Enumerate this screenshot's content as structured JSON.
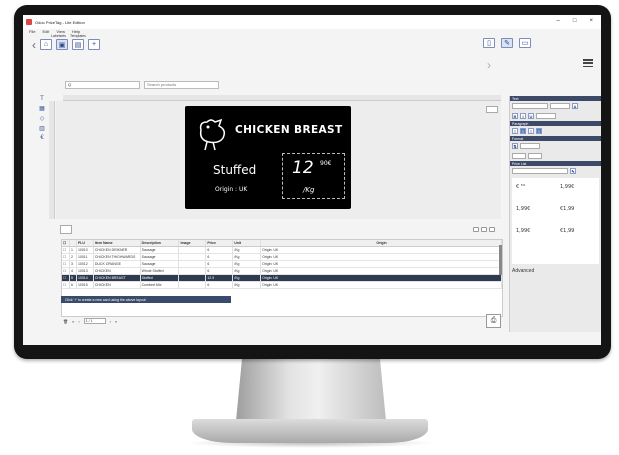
{
  "window": {
    "title": "Odoo PriceTag - Lite Edition",
    "minimize": "–",
    "maximize": "□",
    "close": "×"
  },
  "menu": [
    "File",
    "Edit",
    "View",
    "Help"
  ],
  "subnav": [
    "Labelsets",
    "Templates"
  ],
  "search": {
    "value": "Q",
    "placeholder": "Search products"
  },
  "label": {
    "title": "CHICKEN BREAST",
    "description": "Stuffed",
    "origin": "Origin : UK",
    "price": "12",
    "cents": "90€",
    "unit": "/Kg"
  },
  "table": {
    "headers": [
      "",
      "PLU",
      "Item Name",
      "Description",
      "Image",
      "Price",
      "Unit",
      "Origin"
    ],
    "rows": [
      {
        "num": "1",
        "plu": "10010",
        "name": "CHICKEN DRIKNER",
        "desc": "Sausage",
        "price": "6",
        "unit": "/Kg",
        "origin": "Origin: UK"
      },
      {
        "num": "2",
        "plu": "10011",
        "name": "CHICKEN THIGHWARDS",
        "desc": "Sausage",
        "price": "6",
        "unit": "/Kg",
        "origin": "Origin: UK"
      },
      {
        "num": "3",
        "plu": "10012",
        "name": "DUCK ORANGE",
        "desc": "Sausage",
        "price": "6",
        "unit": "/Kg",
        "origin": "Origin: UK"
      },
      {
        "num": "4",
        "plu": "10013",
        "name": "CHICKEN",
        "desc": "Whole Stuffed",
        "price": "6",
        "unit": "/Kg",
        "origin": "Origin: UK"
      },
      {
        "num": "5",
        "plu": "10014",
        "name": "CHICKEN BREAST",
        "desc": "Stuffed",
        "price": "12.9",
        "unit": "/Kg",
        "origin": "Origin: UK"
      },
      {
        "num": "6",
        "plu": "10015",
        "name": "CHICKEN",
        "desc": "Cumbert Mix",
        "price": "6",
        "unit": "/Kg",
        "origin": "Origin: UK"
      }
    ],
    "hint": "Click '+' to create a new card using the above layout"
  },
  "pager": {
    "value": "1 / 1"
  },
  "panel": {
    "sections": [
      "Text",
      "Paragraph",
      "Format",
      "Price List"
    ],
    "price_list": [
      "€ ⁵°",
      "1,99€",
      "1,99€",
      "€1,99",
      "1,99€",
      "€1,99"
    ],
    "advanced": "Advanced"
  },
  "icons": [
    "chevron-left-icon",
    "home-icon",
    "layout-icon",
    "grid-icon",
    "plus-icon",
    "print-icon",
    "hamburger-icon"
  ]
}
